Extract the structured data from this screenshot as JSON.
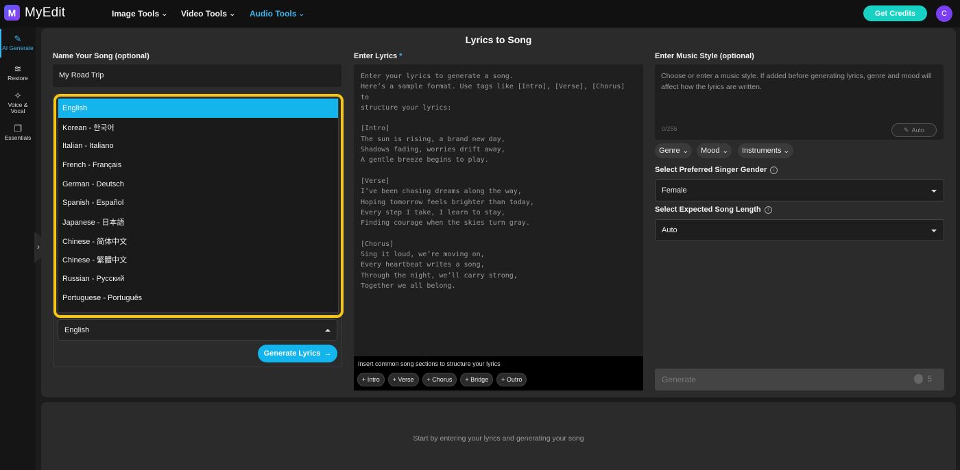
{
  "app": {
    "logo_letter": "M",
    "name": "MyEdit"
  },
  "topnav": [
    {
      "label": "Image Tools",
      "active": false
    },
    {
      "label": "Video Tools",
      "active": false
    },
    {
      "label": "Audio Tools",
      "active": true
    }
  ],
  "header": {
    "credits_label": "Get Credits",
    "avatar_letter": "C"
  },
  "sidebar": [
    {
      "label": "AI Generate",
      "icon": "magic-wand-icon",
      "active": true
    },
    {
      "label": "Restore",
      "icon": "waveform-icon",
      "active": false
    },
    {
      "label": "Voice & Vocal",
      "icon": "vocal-wand-icon",
      "active": false
    },
    {
      "label": "Essentials",
      "icon": "layers-icon",
      "active": false
    }
  ],
  "page": {
    "title": "Lyrics to Song"
  },
  "song": {
    "name_label": "Name Your Song (optional)",
    "name_value": "My Road Trip"
  },
  "language": {
    "selected": "English",
    "options": [
      "English",
      "Korean - 한국어",
      "Italian - Italiano",
      "French - Français",
      "German - Deutsch",
      "Spanish - Español",
      "Japanese - 日本語",
      "Chinese - 简体中文",
      "Chinese - 繁體中文",
      "Russian - Русский",
      "Portuguese - Português"
    ],
    "generate_label": "Generate Lyrics"
  },
  "lyrics": {
    "label": "Enter Lyrics",
    "required_mark": "*",
    "placeholder": "Enter your lyrics to generate a song.\nHere’s a sample format. Use tags like [Intro], [Verse], [Chorus] to\nstructure your lyrics:\n\n[Intro]\nThe sun is rising, a brand new day,\nShadows fading, worries drift away,\nA gentle breeze begins to play.\n\n[Verse]\nI’ve been chasing dreams along the way,\nHoping tomorrow feels brighter than today,\nEvery step I take, I learn to stay,\nFinding courage when the skies turn gray.\n\n[Chorus]\nSing it loud, we’re moving on,\nEvery heartbeat writes a song,\nThrough the night, we’ll carry strong,\nTogether we all belong.",
    "sections_hint": "Insert common song sections to structure your lyrics",
    "sections": [
      "+ Intro",
      "+ Verse",
      "+ Chorus",
      "+ Bridge",
      "+ Outro"
    ]
  },
  "music_style": {
    "label": "Enter Music Style (optional)",
    "placeholder": "Choose or enter a music style. If added before generating lyrics, genre and mood will affect how the lyrics are written.",
    "counter": "0/256",
    "auto_label": "Auto",
    "pills": [
      "Genre",
      "Mood",
      "Instruments"
    ]
  },
  "singer": {
    "label": "Select Preferred Singer Gender",
    "value": "Female"
  },
  "length": {
    "label": "Select Expected Song Length",
    "value": "Auto"
  },
  "generate": {
    "label": "Generate",
    "cost": "5"
  },
  "bottom": {
    "message": "Start by entering your lyrics and generating your song"
  },
  "colors": {
    "accent": "#14b5ec",
    "highlight_outline": "#f5c518",
    "credits": "#17d1c3"
  }
}
